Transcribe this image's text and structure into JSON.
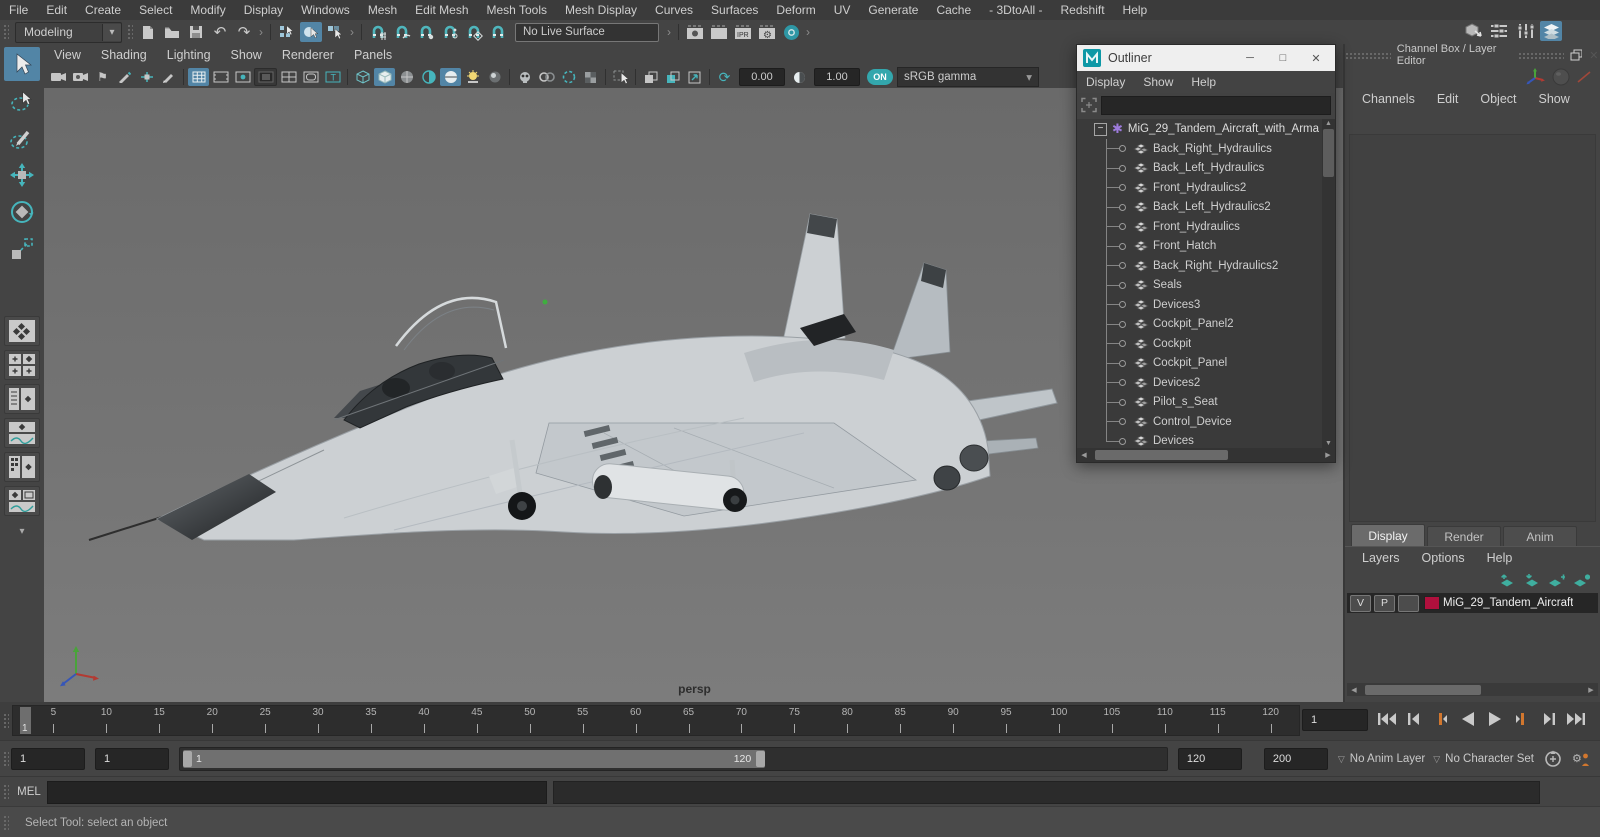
{
  "colors": {
    "accent_blue": "#5285a6",
    "icon_teal": "#46b5bc",
    "layer_red": "#b0103d",
    "maya_logo_teal": "#10a5a8"
  },
  "icons": {
    "caret_down": "▾",
    "caret_outline": "▽",
    "minimize": "─",
    "maximize": "□",
    "close": "✕",
    "scroll_left": "◀",
    "scroll_right": "▶",
    "scroll_up": "▲",
    "scroll_down": "▼",
    "asterisk": "✱",
    "minus": "−",
    "undo": "↶",
    "redo": "↷",
    "flag": "⚑",
    "gear": "⚙",
    "refresh": "⟳",
    "group_arrow": "›",
    "safe_title": "T"
  },
  "menu_bar": {
    "items": [
      "File",
      "Edit",
      "Create",
      "Select",
      "Modify",
      "Display",
      "Windows",
      "Mesh",
      "Edit Mesh",
      "Mesh Tools",
      "Mesh Display",
      "Curves",
      "Surfaces",
      "Deform",
      "UV",
      "Generate",
      "Cache",
      "- 3DtoAll -",
      "Redshift",
      "Help"
    ]
  },
  "status_line": {
    "menuset": "Modeling",
    "live_surface": "No Live Surface",
    "ipr_label": "IPR"
  },
  "panel": {
    "menus": [
      "View",
      "Shading",
      "Lighting",
      "Show",
      "Renderer",
      "Panels"
    ],
    "exposure": "0.00",
    "gamma": "1.00",
    "on_label": "ON",
    "colorspace": "sRGB gamma",
    "camera": "persp"
  },
  "outliner": {
    "title": "Outliner",
    "menus": [
      "Display",
      "Show",
      "Help"
    ],
    "search_value": "",
    "root_item": "MiG_29_Tandem_Aircraft_with_Arma",
    "items": [
      "Back_Right_Hydraulics",
      "Back_Left_Hydraulics",
      "Front_Hydraulics2",
      "Back_Left_Hydraulics2",
      "Front_Hydraulics",
      "Front_Hatch",
      "Back_Right_Hydraulics2",
      "Seals",
      "Devices3",
      "Cockpit_Panel2",
      "Cockpit",
      "Cockpit_Panel",
      "Devices2",
      "Pilot_s_Seat",
      "Control_Device",
      "Devices"
    ]
  },
  "channel_box": {
    "title": "Channel Box / Layer Editor",
    "menus": [
      "Channels",
      "Edit",
      "Object",
      "Show"
    ]
  },
  "layer_editor": {
    "tabs": [
      "Display",
      "Render",
      "Anim"
    ],
    "active_tab": "Display",
    "menus": [
      "Layers",
      "Options",
      "Help"
    ],
    "layer": {
      "visibility": "V",
      "playback": "P",
      "name": "MiG_29_Tandem_Aircraft"
    }
  },
  "time_slider": {
    "tick_labels": [
      "5",
      "10",
      "15",
      "20",
      "25",
      "30",
      "35",
      "40",
      "45",
      "50",
      "55",
      "60",
      "65",
      "70",
      "75",
      "80",
      "85",
      "90",
      "95",
      "100",
      "105",
      "110",
      "115",
      "120"
    ],
    "current_frame": "1",
    "frame_field": "1"
  },
  "range_slider": {
    "start": "1",
    "playback_start": "1",
    "slider_start": "1",
    "slider_end": "120",
    "playback_end": "120",
    "end": "200",
    "anim_layer": "No Anim Layer",
    "character_set": "No Character Set"
  },
  "command_line": {
    "label": "MEL",
    "input": "",
    "output": ""
  },
  "help_line": {
    "text": "Select Tool: select an object"
  }
}
